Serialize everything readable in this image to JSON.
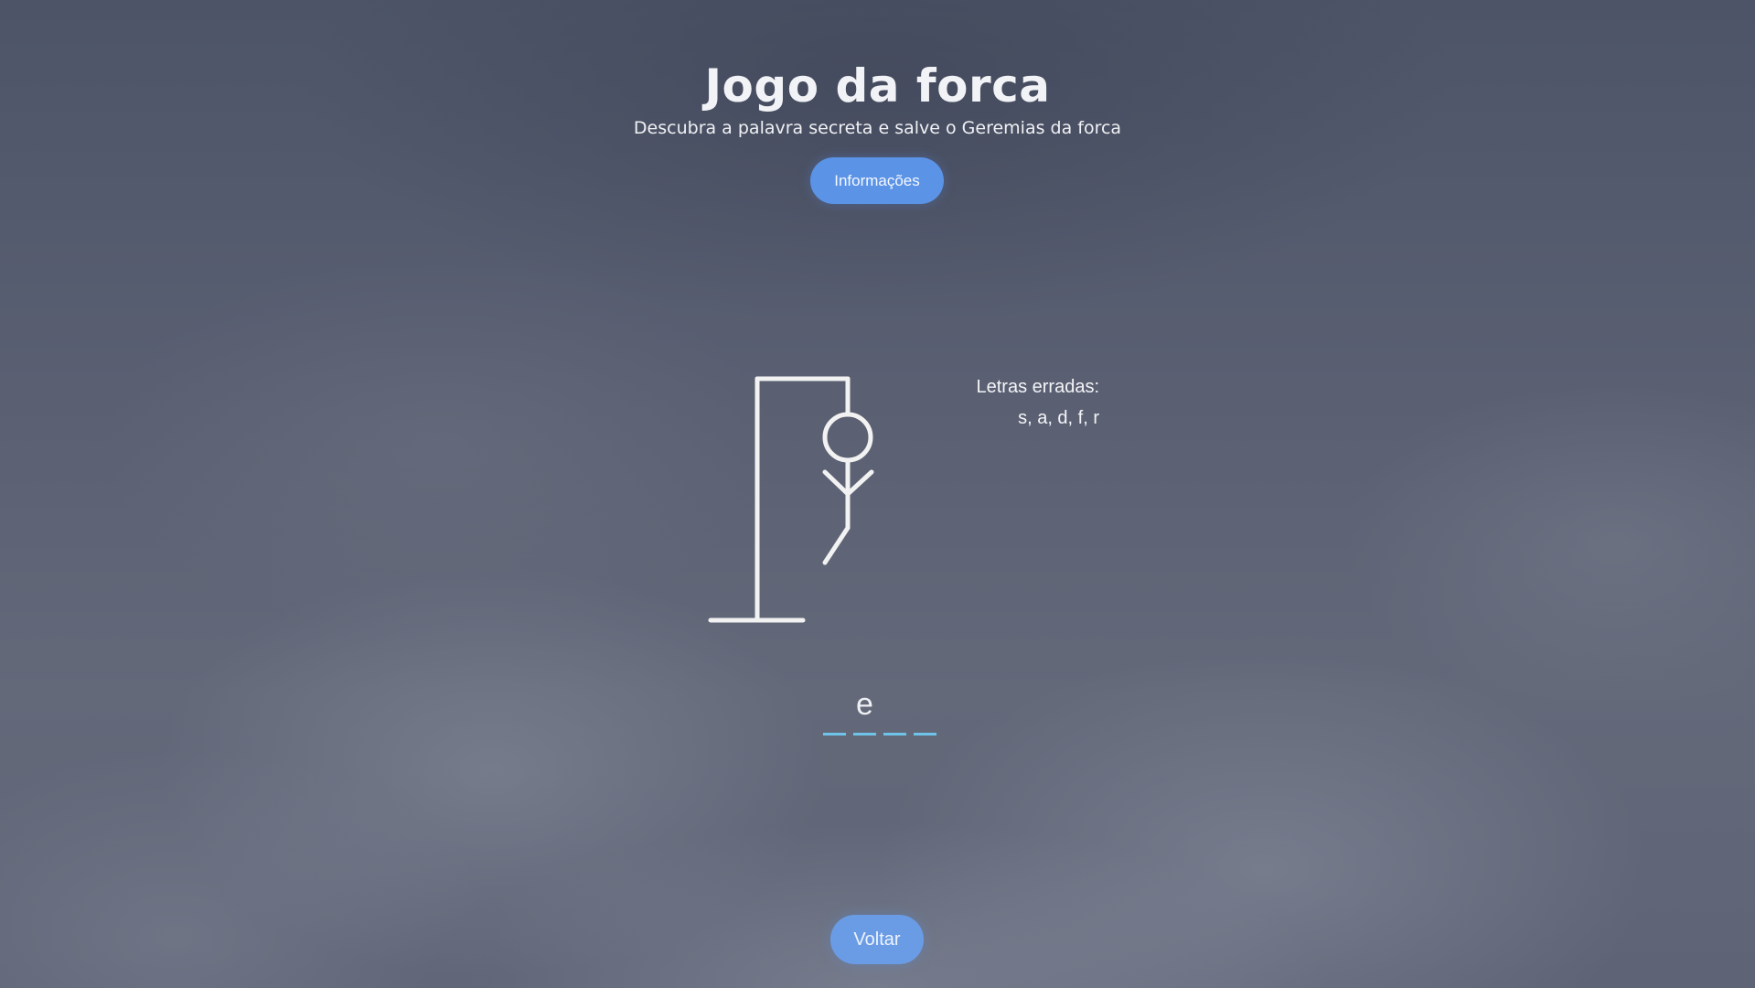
{
  "header": {
    "title": "Jogo da forca",
    "subtitle": "Descubra a palavra secreta e salve o Geremias da forca"
  },
  "buttons": {
    "info_label": "Informações",
    "back_label": "Voltar"
  },
  "wrong_letters": {
    "label": "Letras erradas:",
    "list": "s, a, d, f, r"
  },
  "word": {
    "slots": [
      "",
      "e",
      "",
      ""
    ]
  },
  "hangman": {
    "parts_shown": [
      "head",
      "body",
      "left-arm",
      "right-arm",
      "left-leg"
    ]
  },
  "colors": {
    "button": "#5b93e6",
    "slot_underline": "#6fc3e9",
    "drawing": "#f2f2f2"
  }
}
